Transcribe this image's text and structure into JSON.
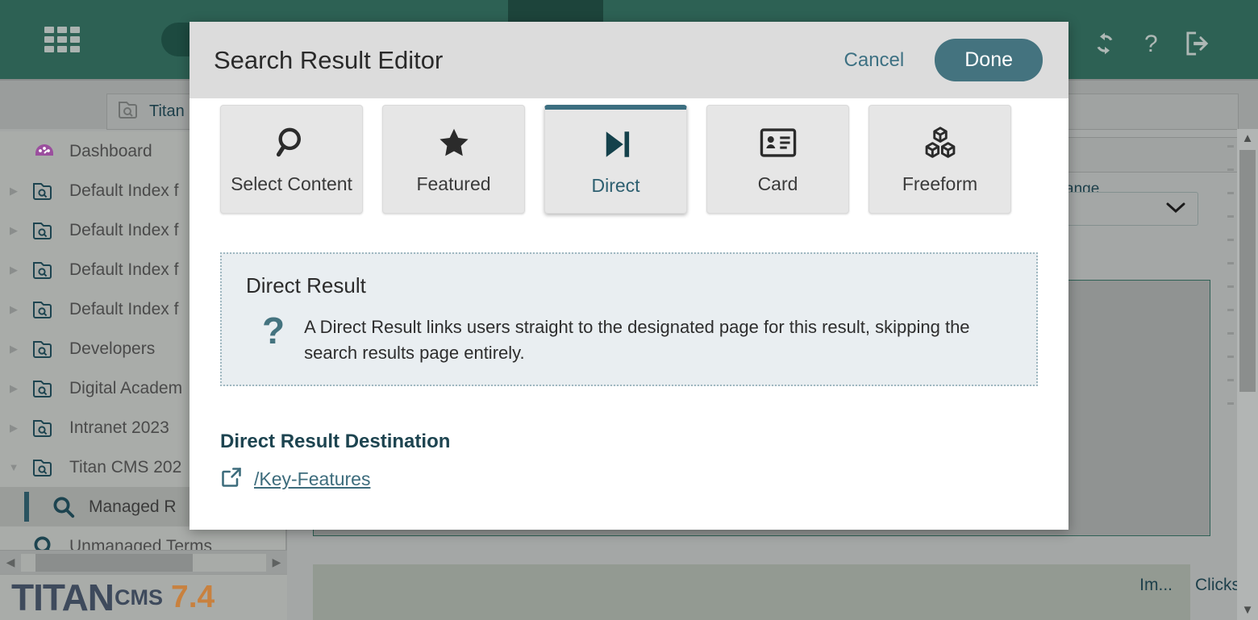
{
  "app": {
    "header": {
      "grid_icon": "grid-apps-icon",
      "refresh_icon": "refresh-icon",
      "help_icon": "help-question-icon",
      "logout_icon": "logout-icon"
    },
    "breadcrumb": {
      "icon": "search-folder-icon",
      "text": "Titan"
    },
    "tree": {
      "items": [
        {
          "label": "Dashboard",
          "icon": "dashboard-icon",
          "twisty": "",
          "selected": false
        },
        {
          "label": "Default Index f",
          "icon": "search-folder-icon",
          "twisty": "▶",
          "selected": false
        },
        {
          "label": "Default Index f",
          "icon": "search-folder-icon",
          "twisty": "▶",
          "selected": false
        },
        {
          "label": "Default Index f",
          "icon": "search-folder-icon",
          "twisty": "▶",
          "selected": false
        },
        {
          "label": "Default Index f",
          "icon": "search-folder-icon",
          "twisty": "▶",
          "selected": false
        },
        {
          "label": "Developers",
          "icon": "search-folder-icon",
          "twisty": "▶",
          "selected": false
        },
        {
          "label": "Digital Academ",
          "icon": "search-folder-icon",
          "twisty": "▶",
          "selected": false
        },
        {
          "label": "Intranet 2023",
          "icon": "search-folder-icon",
          "twisty": "▶",
          "selected": false
        },
        {
          "label": "Titan CMS 202",
          "icon": "search-folder-icon",
          "twisty": "▼",
          "selected": false
        },
        {
          "label": "Managed R",
          "icon": "magnifier-icon",
          "twisty": "",
          "selected": true
        },
        {
          "label": "Unmanaged Terms",
          "icon": "magnifier-icon",
          "twisty": "",
          "selected": false
        }
      ]
    },
    "logo": {
      "part1": "TITAN",
      "part2": "CMS",
      "part3": "7.4"
    },
    "right_panel": {
      "select_label": "ange",
      "table_headers": [
        "Im...",
        "Clicks"
      ]
    }
  },
  "modal": {
    "title": "Search Result Editor",
    "cancel_label": "Cancel",
    "done_label": "Done",
    "tabs": [
      {
        "label": "Select Content",
        "icon": "magnifier-icon",
        "active": false
      },
      {
        "label": "Featured",
        "icon": "star-icon",
        "active": false
      },
      {
        "label": "Direct",
        "icon": "skip-forward-icon",
        "active": true
      },
      {
        "label": "Card",
        "icon": "id-card-icon",
        "active": false
      },
      {
        "label": "Freeform",
        "icon": "cubes-icon",
        "active": false
      }
    ],
    "info": {
      "heading": "Direct Result",
      "icon": "question-mark-icon",
      "text": "A Direct Result links users straight to the designated page for this result, skipping the search results page entirely."
    },
    "destination": {
      "title": "Direct Result Destination",
      "link_icon": "external-link-icon",
      "link_text": "/Key-Features"
    }
  },
  "colors": {
    "header_green": "#2d6154",
    "accent_teal": "#44737f",
    "active_tab_border": "#3b6e80",
    "link": "#3d6c7c",
    "info_bg": "#e9eef1"
  }
}
